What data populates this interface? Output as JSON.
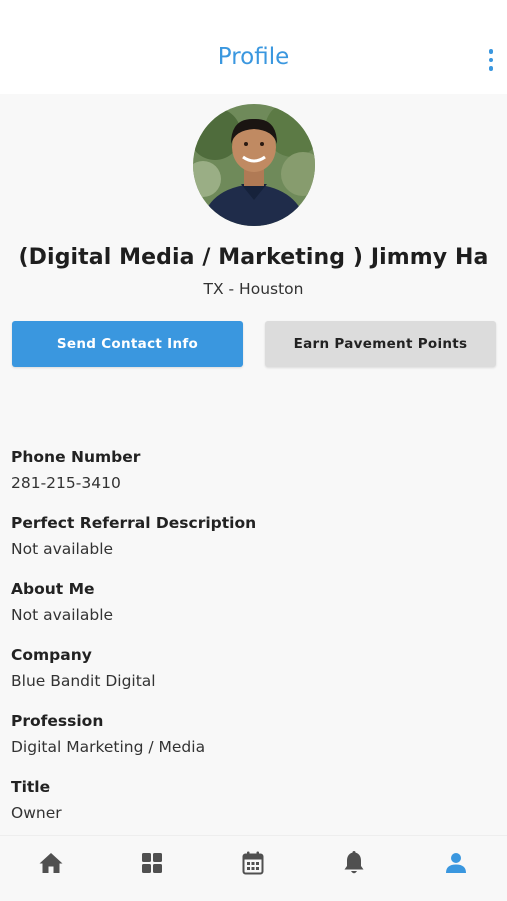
{
  "header": {
    "title": "Profile",
    "more_icon": "more-vertical-icon"
  },
  "profile": {
    "name": "(Digital Media / Marketing ) Jimmy Ha",
    "location": "TX - Houston"
  },
  "actions": {
    "send_label": "Send Contact Info",
    "earn_label": "Earn Pavement Points"
  },
  "details": [
    {
      "label": "Phone Number",
      "value": "281-215-3410"
    },
    {
      "label": "Perfect Referral Description",
      "value": "Not available"
    },
    {
      "label": "About Me",
      "value": "Not available"
    },
    {
      "label": "Company",
      "value": "Blue Bandit Digital"
    },
    {
      "label": "Profession",
      "value": "Digital Marketing / Media"
    },
    {
      "label": "Title",
      "value": "Owner"
    }
  ],
  "tabbar": {
    "items": [
      {
        "icon": "home-icon",
        "active": false
      },
      {
        "icon": "dashboard-grid-icon",
        "active": false
      },
      {
        "icon": "calendar-icon",
        "active": false
      },
      {
        "icon": "bell-icon",
        "active": false
      },
      {
        "icon": "person-icon",
        "active": true
      }
    ]
  },
  "colors": {
    "accent": "#3a97df",
    "inactive_icon": "#505050",
    "secondary_button": "#dcdcdc",
    "background": "#f8f8f8"
  }
}
